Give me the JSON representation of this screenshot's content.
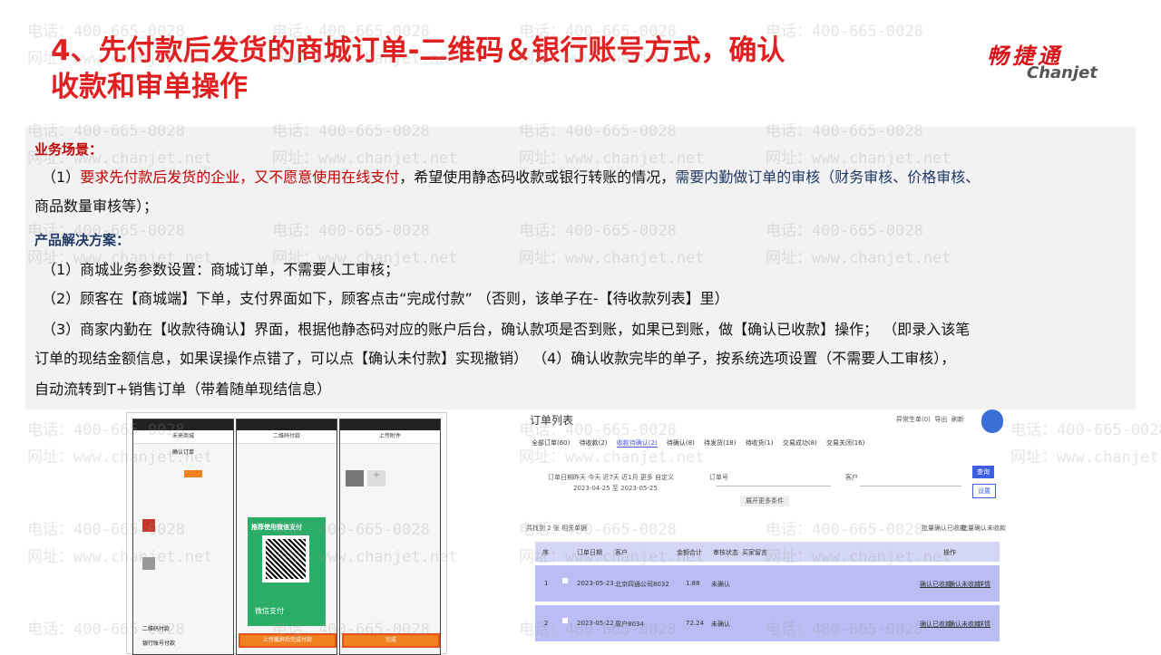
{
  "title": {
    "line1": "4、先付款后发货的商城订单-二维码＆银行账号方式，确认",
    "line2": "收款和审单操作"
  },
  "logo": {
    "cn": "畅捷通",
    "en": "Chanjet"
  },
  "watermark": {
    "phone": "电话：400-665-0028",
    "site": "网址：www.chanjet.net"
  },
  "content": {
    "scenario_heading": "业务场景：",
    "scenario_prefix": "（1）",
    "scenario_red": "要求先付款后发货的企业，又不愿意使用在线支付",
    "scenario_mid": "，希望使用静态码收款或银行转账的情况，",
    "scenario_blue": "需要内勤做订单的审核（财务审核、价格审核、",
    "scenario_line2": "商品数量审核等）；",
    "solution_heading": "产品解决方案：",
    "steps": [
      "（1）商城业务参数设置：商城订单，不需要人工审核；",
      "（2）顾客在【商城端】下单，支付界面如下，顾客点击“完成付款”  （否则，该单子在-【待收款列表】里）",
      "（3）商家内勤在【收款待确认】界面，根据他静态码对应的账户后台，确认款项是否到账，如果已到账，做【确认已收款】操作；  （即录入该笔",
      "订单的现结金额信息，如果误操作点错了，可以点【确认未付款】实现撤销）  （4）确认收款完毕的单子，按系统选项设置（不需要人工审核），",
      "自动流转到T+销售订单（带着随单现结信息）"
    ]
  },
  "phone_screens": {
    "p1_title": "未来商城",
    "p1_sub": "确认订单",
    "p1_bottom1": "二维码付款",
    "p1_bottom2": "银行账号付款",
    "p2_title": "二维码付款",
    "p2_recommend": "推荐使用微信支付",
    "p2_wechat": "微信支付",
    "p2_btn": "上传截屏后完成付款",
    "p3_title": "上传附件",
    "p3_btn": "完成"
  },
  "order_list": {
    "title": "订单列表",
    "tabs": [
      "全部订单(60)",
      "待收款(2)",
      "收款待确认(2)",
      "待确认(8)",
      "待发货(18)",
      "待收货(1)",
      "交易成功(8)",
      "交易关闭(16)"
    ],
    "toolbar": [
      "异常生单(0)",
      "导出",
      "刷新"
    ],
    "filters": {
      "order_date_label": "订单日期",
      "date_opts": "昨天 今天 近7天 近1月 更多 自定义",
      "date_range": "2023-04-25 至 2023-05-25",
      "order_no_label": "订单号",
      "customer_label": "客户",
      "query_btn": "查询",
      "reset_btn": "设置",
      "expand": "展开更多条件"
    },
    "summary": "共找到 2 张 相关单据",
    "batch_confirm": "批量确认已收款",
    "batch_unpaid": "批量确认未收款",
    "columns": [
      "序",
      "",
      "订单日期",
      "客户",
      "金额合计",
      "审核状态",
      "买家留言",
      "操作"
    ],
    "rows": [
      {
        "no": "1",
        "date": "2023-05-23",
        "customer": "北京四通公司8032",
        "amount": "1.88",
        "status": "未确认",
        "act1": "确认已收款",
        "act2": "确认未收款",
        "act3": "详情"
      },
      {
        "no": "2",
        "date": "2023-05-22",
        "customer": "周户8034",
        "amount": "72.24",
        "status": "未确认",
        "act1": "确认已收款",
        "act2": "确认未收款",
        "act3": "详情"
      }
    ]
  }
}
